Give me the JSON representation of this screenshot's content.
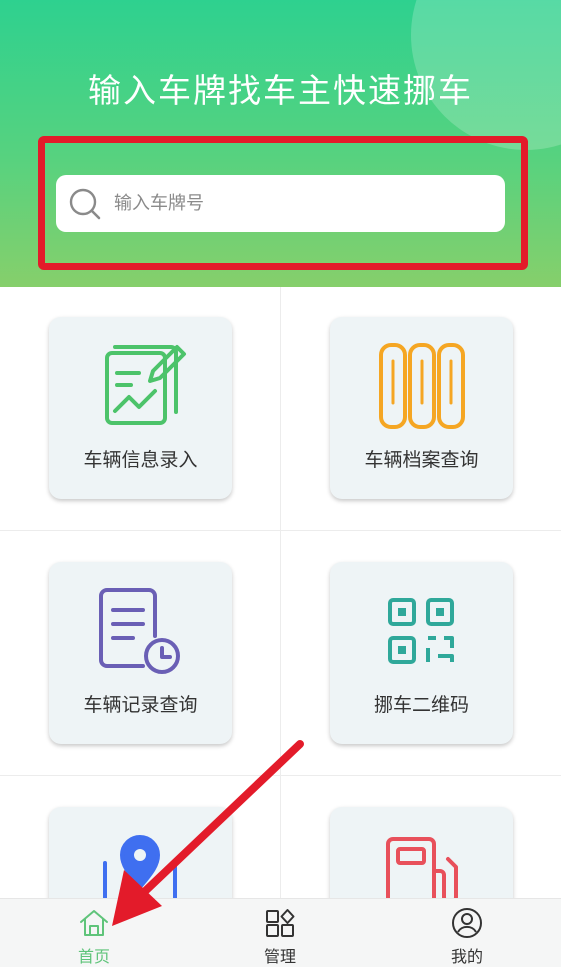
{
  "header": {
    "title": "输入车牌找车主快速挪车"
  },
  "search": {
    "placeholder": "输入车牌号",
    "icon": "search-icon"
  },
  "features": [
    {
      "label": "车辆信息录入",
      "icon": "edit-document-icon",
      "color": "#4cc36a"
    },
    {
      "label": "车辆档案查询",
      "icon": "archive-binders-icon",
      "color": "#f5a623"
    },
    {
      "label": "车辆记录查询",
      "icon": "record-clock-icon",
      "color": "#6a5fb5"
    },
    {
      "label": "挪车二维码",
      "icon": "qr-code-icon",
      "color": "#2fa89a"
    },
    {
      "label": "",
      "icon": "map-location-icon",
      "color": "#3f6ff0"
    },
    {
      "label": "",
      "icon": "fuel-pump-icon",
      "color": "#e8505b"
    }
  ],
  "nav": {
    "items": [
      {
        "label": "首页",
        "icon": "home-icon",
        "active": true
      },
      {
        "label": "管理",
        "icon": "grid-icon",
        "active": false
      },
      {
        "label": "我的",
        "icon": "user-icon",
        "active": false
      }
    ],
    "active_color": "#5fc47a"
  },
  "annotations": {
    "highlight_color": "#e31b2a"
  }
}
